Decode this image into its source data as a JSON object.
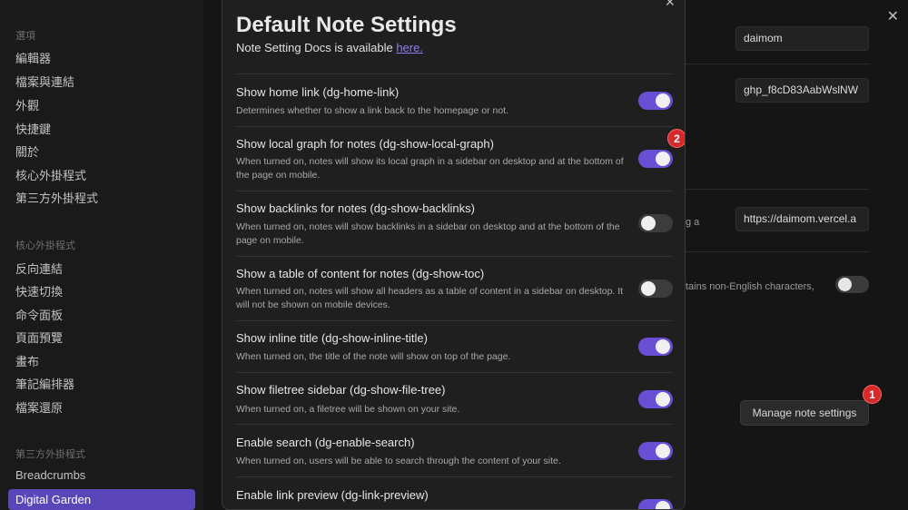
{
  "sidebar": {
    "group_options": "選項",
    "options": [
      "編輯器",
      "檔案與連結",
      "外觀",
      "快捷鍵",
      "關於",
      "核心外掛程式",
      "第三方外掛程式"
    ],
    "group_core": "核心外掛程式",
    "core": [
      "反向連結",
      "快速切換",
      "命令面板",
      "頁面預覽",
      "畫布",
      "筆記編排器",
      "檔案還原"
    ],
    "group_third": "第三方外掛程式",
    "third": [
      "Breadcrumbs",
      "Digital Garden"
    ]
  },
  "background": {
    "username_value": "daimom",
    "token_value": "ghp_f8cD83AabWslNW",
    "url_value": "https://daimom.vercel.a",
    "partial_text_1": "g a",
    "partial_text_2": "tains non-English characters,",
    "manage_label": "Manage note settings",
    "badge1": "1"
  },
  "modal": {
    "title": "Default Note Settings",
    "docs_text": "Note Setting Docs is available ",
    "docs_link": "here.",
    "badge2": "2",
    "settings": [
      {
        "name": "Show home link (dg-home-link)",
        "desc": "Determines whether to show a link back to the homepage or not.",
        "on": true
      },
      {
        "name": "Show local graph for notes (dg-show-local-graph)",
        "desc": "When turned on, notes will show its local graph in a sidebar on desktop and at the bottom of the page on mobile.",
        "on": true
      },
      {
        "name": "Show backlinks for notes (dg-show-backlinks)",
        "desc": "When turned on, notes will show backlinks in a sidebar on desktop and at the bottom of the page on mobile.",
        "on": false
      },
      {
        "name": "Show a table of content for notes (dg-show-toc)",
        "desc": "When turned on, notes will show all headers as a table of content in a sidebar on desktop. It will not be shown on mobile devices.",
        "on": false
      },
      {
        "name": "Show inline title (dg-show-inline-title)",
        "desc": "When turned on, the title of the note will show on top of the page.",
        "on": true
      },
      {
        "name": "Show filetree sidebar (dg-show-file-tree)",
        "desc": "When turned on, a filetree will be shown on your site.",
        "on": true
      },
      {
        "name": "Enable search (dg-enable-search)",
        "desc": "When turned on, users will be able to search through the content of your site.",
        "on": true
      },
      {
        "name": "Enable link preview (dg-link-preview)",
        "desc": "",
        "on": true
      }
    ]
  }
}
